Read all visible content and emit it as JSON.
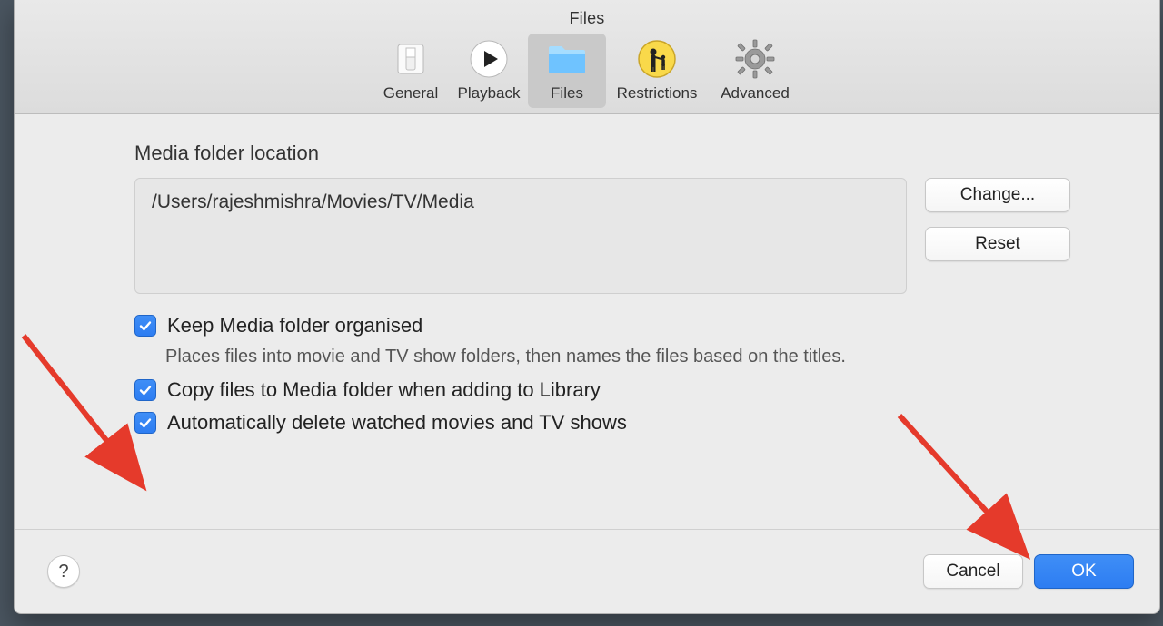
{
  "window": {
    "title": "Files"
  },
  "toolbar": {
    "items": [
      {
        "label": "General"
      },
      {
        "label": "Playback"
      },
      {
        "label": "Files"
      },
      {
        "label": "Restrictions"
      },
      {
        "label": "Advanced"
      }
    ],
    "selected_index": 2
  },
  "section": {
    "title": "Media folder location",
    "path": "/Users/rajeshmishra/Movies/TV/Media",
    "change_label": "Change...",
    "reset_label": "Reset"
  },
  "options": {
    "keep_organised": {
      "label": "Keep Media folder organised",
      "hint": "Places files into movie and TV show folders, then names the files based on the titles.",
      "checked": true
    },
    "copy_files": {
      "label": "Copy files to Media folder when adding to Library",
      "checked": true
    },
    "auto_delete": {
      "label": "Automatically delete watched movies and TV shows",
      "checked": true
    }
  },
  "footer": {
    "help_label": "?",
    "cancel_label": "Cancel",
    "ok_label": "OK"
  }
}
